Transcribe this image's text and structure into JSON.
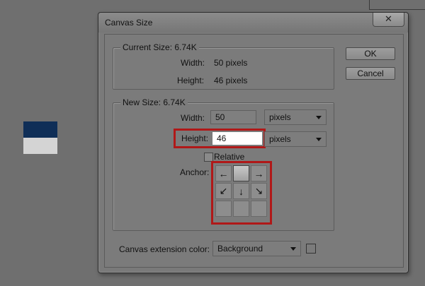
{
  "dialog": {
    "title": "Canvas Size",
    "close_label": "✕",
    "ok_label": "OK",
    "cancel_label": "Cancel"
  },
  "current_size": {
    "legend": "Current Size: 6.74K",
    "width_label": "Width:",
    "width_value": "50 pixels",
    "height_label": "Height:",
    "height_value": "46 pixels"
  },
  "new_size": {
    "legend": "New Size: 6.74K",
    "width_label": "Width:",
    "width_value": "50",
    "width_unit": "pixels",
    "height_label": "Height:",
    "height_value": "46",
    "height_unit": "pixels",
    "relative_label": "Relative",
    "relative_checked": false,
    "anchor_label": "Anchor:",
    "anchor_cells": [
      "←",
      "",
      "→",
      "↙",
      "↓",
      "↘",
      "",
      "",
      ""
    ],
    "anchor_selected": "top-center"
  },
  "extension": {
    "label": "Canvas extension color:",
    "value": "Background"
  },
  "colors": {
    "highlight": "#b01818",
    "swatch_top": "#0f2e57",
    "swatch_bottom": "#d4d4d4"
  }
}
